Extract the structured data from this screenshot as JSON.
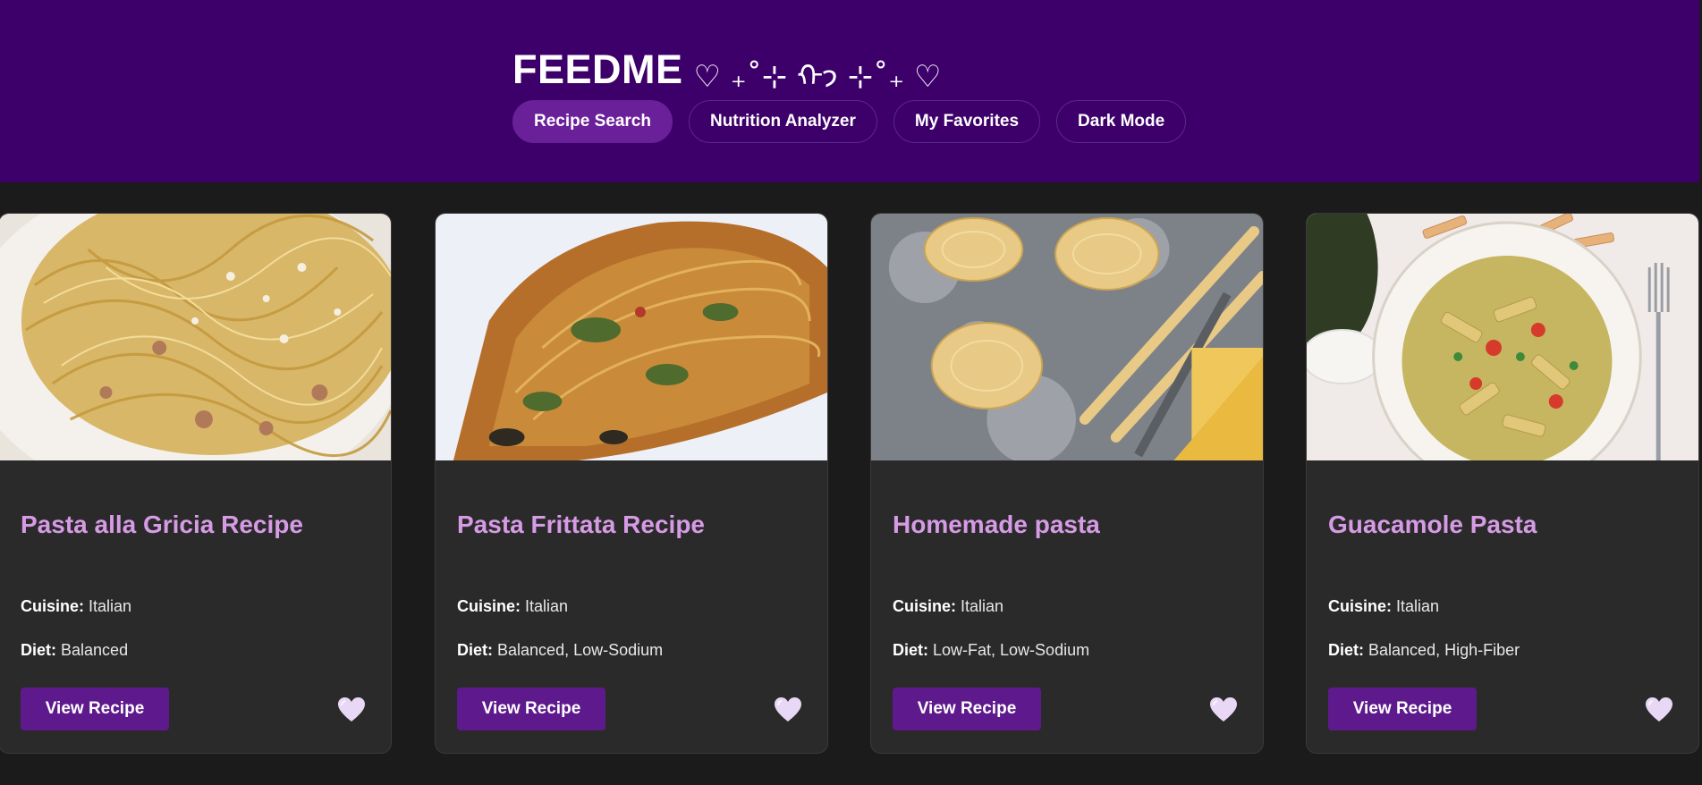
{
  "header": {
    "title": "FEEDME",
    "decoration": "♡ ₊˚⊹ ᡣ𐭩 ⊹˚₊ ♡",
    "nav": [
      {
        "label": "Recipe Search",
        "active": true
      },
      {
        "label": "Nutrition Analyzer",
        "active": false
      },
      {
        "label": "My Favorites",
        "active": false
      },
      {
        "label": "Dark Mode",
        "active": false
      }
    ]
  },
  "recipes": [
    {
      "title": "Pasta alla Gricia Recipe",
      "cuisine_label": "Cuisine:",
      "cuisine": "Italian",
      "diet_label": "Diet:",
      "diet": "Balanced",
      "button": "View Recipe",
      "favorite_icon": "heart-icon"
    },
    {
      "title": "Pasta Frittata Recipe",
      "cuisine_label": "Cuisine:",
      "cuisine": "Italian",
      "diet_label": "Diet:",
      "diet": "Balanced, Low-Sodium",
      "button": "View Recipe",
      "favorite_icon": "heart-icon"
    },
    {
      "title": "Homemade pasta",
      "cuisine_label": "Cuisine:",
      "cuisine": "Italian",
      "diet_label": "Diet:",
      "diet": "Low-Fat, Low-Sodium",
      "button": "View Recipe",
      "favorite_icon": "heart-icon"
    },
    {
      "title": "Guacamole Pasta",
      "cuisine_label": "Cuisine:",
      "cuisine": "Italian",
      "diet_label": "Diet:",
      "diet": "Balanced, High-Fiber",
      "button": "View Recipe",
      "favorite_icon": "heart-icon"
    }
  ],
  "colors": {
    "header_bg": "#3d006a",
    "page_bg": "#1b1b1b",
    "card_bg": "#2a2a2a",
    "title_color": "#d79be6",
    "button_bg": "#5e1a8c",
    "heart": "#e8d8f5"
  }
}
